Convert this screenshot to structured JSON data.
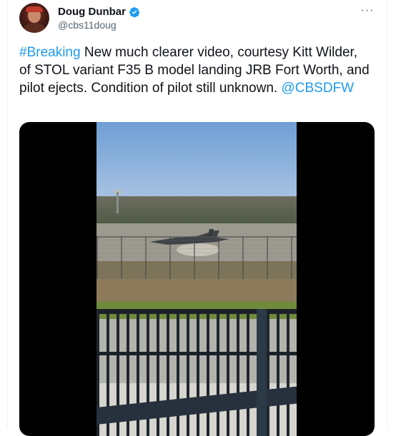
{
  "tweet": {
    "author": {
      "display_name": "Doug Dunbar",
      "handle": "@cbs11doug",
      "verified": true
    },
    "more_menu_label": "···",
    "text_segments": [
      {
        "text": "#Breaking",
        "type": "link"
      },
      {
        "text": " New much clearer video, courtesy Kitt Wilder, of STOL variant F35 B model landing JRB Fort Worth, and pilot ejects. Condition of pilot still unknown. ",
        "type": "text"
      },
      {
        "text": "@CBSDFW",
        "type": "link"
      }
    ],
    "media": {
      "type": "video"
    }
  },
  "icons": {
    "verified": "verified-badge-icon",
    "more": "more-options-icon"
  },
  "colors": {
    "link": "#1d9bf0",
    "text": "#0f1419",
    "secondary_text": "#536471",
    "border": "#eff3f4"
  }
}
